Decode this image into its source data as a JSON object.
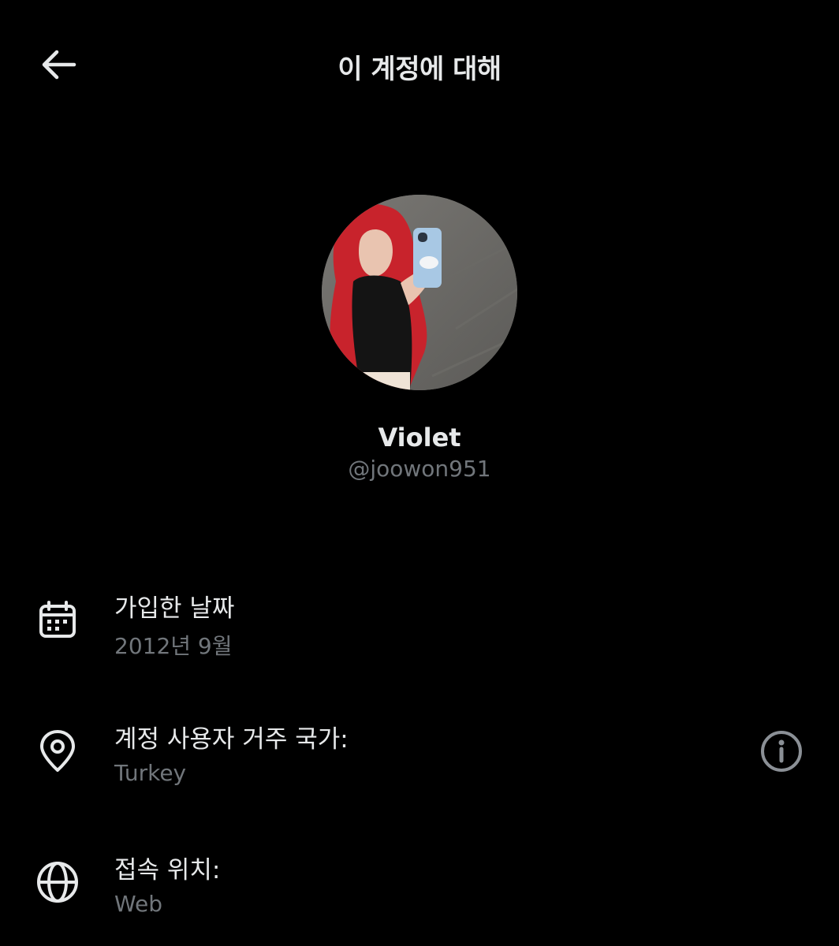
{
  "header": {
    "title": "이 계정에 대해",
    "back_icon": "arrow-left-icon"
  },
  "profile": {
    "display_name": "Violet",
    "handle": "@joowon951",
    "avatar_icon": "profile-photo"
  },
  "details": [
    {
      "icon": "calendar-icon",
      "label": "가입한 날짜",
      "value": "2012년 9월"
    },
    {
      "icon": "location-pin-icon",
      "label": "계정 사용자 거주 국가:",
      "value": "Turkey",
      "help_icon": "info-circle-icon"
    },
    {
      "icon": "globe-icon",
      "label": "접속 위치:",
      "value": "Web"
    }
  ],
  "colors": {
    "background": "#000000",
    "primary_text": "#e7e9ea",
    "secondary_text": "#71767b"
  }
}
